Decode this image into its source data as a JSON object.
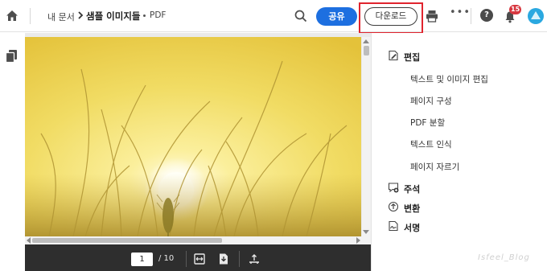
{
  "header": {
    "breadcrumb_root": "내 문서",
    "file_name": "샘플 이미지들",
    "file_type": "PDF",
    "share_label": "공유",
    "download_label": "다운로드",
    "notification_count": "15"
  },
  "viewer": {
    "current_page": "1",
    "total_pages": "/ 10"
  },
  "panel": {
    "edit_label": "편집",
    "edit_items": [
      "텍스트 및 이미지 편집",
      "페이지 구성",
      "PDF 분할",
      "텍스트 인식",
      "페이지 자르기"
    ],
    "comment_label": "주석",
    "convert_label": "변환",
    "sign_label": "서명"
  },
  "watermark": "Isfeel_Blog",
  "colors": {
    "share_button": "#1d6fe0",
    "highlight_box": "#e0242e",
    "page_toolbar": "#2e2e2e"
  }
}
